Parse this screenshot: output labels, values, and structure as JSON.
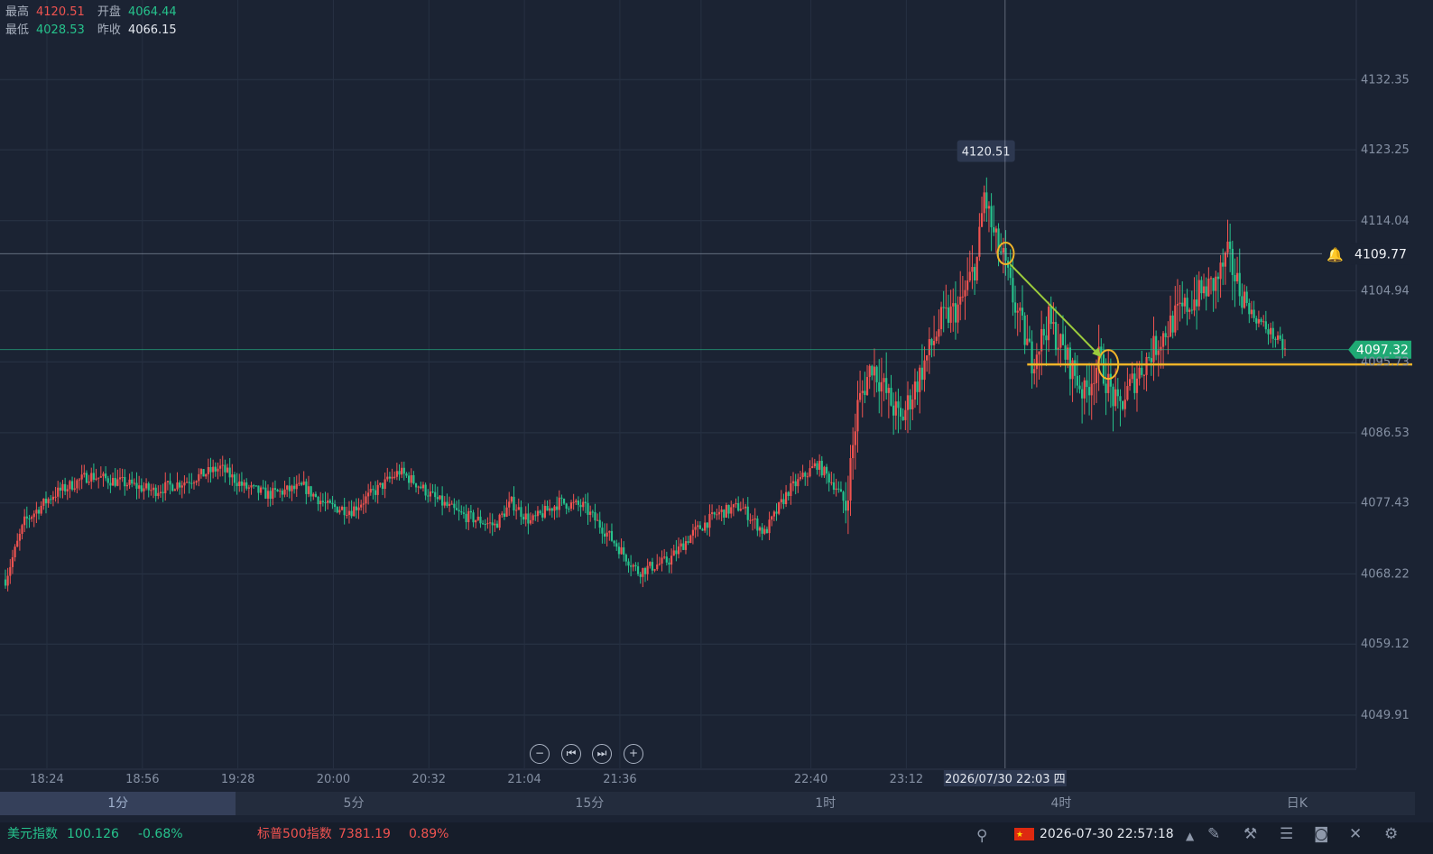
{
  "stats": {
    "high_label": "最高",
    "high_value": "4120.51",
    "open_label": "开盘",
    "open_value": "4064.44",
    "low_label": "最低",
    "low_value": "4028.53",
    "prev_close_label": "昨收",
    "prev_close_value": "4066.15"
  },
  "chart_data": {
    "type": "candlestick",
    "y_ticks": [
      4132.35,
      4123.25,
      4114.04,
      4104.94,
      4095.73,
      4086.53,
      4077.43,
      4068.22,
      4059.12,
      4049.91
    ],
    "ylim": [
      4043.0,
      4138.0
    ],
    "x_ticks": [
      "18:24",
      "18:56",
      "19:28",
      "20:00",
      "20:32",
      "21:04",
      "21:36",
      "22:03",
      "22:40",
      "23:12"
    ],
    "crosshair_time_label": "2026/07/30 22:03 四",
    "crosshair_price": "4109.77",
    "crosshair_price_value": 4109.77,
    "current_price": "4097.32",
    "current_price_value": 4097.32,
    "peak_label": "4120.51",
    "peak_value": 4120.51,
    "annotation_line_price": 4095.4,
    "up_color": "#ef5350",
    "down_color": "#26c28c",
    "annotation_color": "#f0b429",
    "arrow_color": "#9ccc3c",
    "key_points": [
      [
        0,
        4067.5
      ],
      [
        8,
        4075.0
      ],
      [
        20,
        4078.5
      ],
      [
        35,
        4081.0
      ],
      [
        50,
        4080.0
      ],
      [
        62,
        4079.0
      ],
      [
        75,
        4080.2
      ],
      [
        90,
        4082.0
      ],
      [
        100,
        4079.5
      ],
      [
        110,
        4078.5
      ],
      [
        125,
        4079.5
      ],
      [
        135,
        4077.0
      ],
      [
        145,
        4076.5
      ],
      [
        155,
        4079.0
      ],
      [
        165,
        4081.5
      ],
      [
        172,
        4080.0
      ],
      [
        180,
        4078.0
      ],
      [
        190,
        4076.0
      ],
      [
        205,
        4074.5
      ],
      [
        212,
        4077.5
      ],
      [
        220,
        4075.0
      ],
      [
        232,
        4077.5
      ],
      [
        242,
        4077.0
      ],
      [
        252,
        4073.5
      ],
      [
        265,
        4068.5
      ],
      [
        278,
        4070.0
      ],
      [
        288,
        4073.5
      ],
      [
        298,
        4076.0
      ],
      [
        308,
        4077.0
      ],
      [
        318,
        4073.5
      ],
      [
        328,
        4079.0
      ],
      [
        340,
        4082.5
      ],
      [
        348,
        4079.5
      ],
      [
        352,
        4077.0
      ],
      [
        357,
        4090.0
      ],
      [
        363,
        4095.5
      ],
      [
        370,
        4091.0
      ],
      [
        375,
        4088.0
      ],
      [
        383,
        4094.0
      ],
      [
        392,
        4101.0
      ],
      [
        400,
        4103.0
      ],
      [
        407,
        4109.0
      ],
      [
        410,
        4117.5
      ],
      [
        414,
        4112.0
      ],
      [
        418,
        4109.0
      ],
      [
        422,
        4104.0
      ],
      [
        430,
        4096.0
      ],
      [
        437,
        4101.0
      ],
      [
        445,
        4096.0
      ],
      [
        452,
        4091.5
      ],
      [
        458,
        4096.0
      ],
      [
        466,
        4089.5
      ],
      [
        472,
        4093.0
      ],
      [
        480,
        4097.0
      ],
      [
        490,
        4101.5
      ],
      [
        500,
        4104.5
      ],
      [
        507,
        4106.0
      ],
      [
        512,
        4109.5
      ],
      [
        516,
        4106.0
      ],
      [
        522,
        4102.0
      ],
      [
        530,
        4099.5
      ],
      [
        536,
        4097.3
      ]
    ]
  },
  "tabs": [
    "1分",
    "5分",
    "15分",
    "1时",
    "4时",
    "日K"
  ],
  "footer": {
    "dxy_name": "美元指数",
    "dxy_value": "100.126",
    "dxy_change": "-0.68%",
    "spx_name": "标普500指数",
    "spx_value": "7381.19",
    "spx_change": "0.89%",
    "datetime": "2026-07-30 22:57:18"
  }
}
